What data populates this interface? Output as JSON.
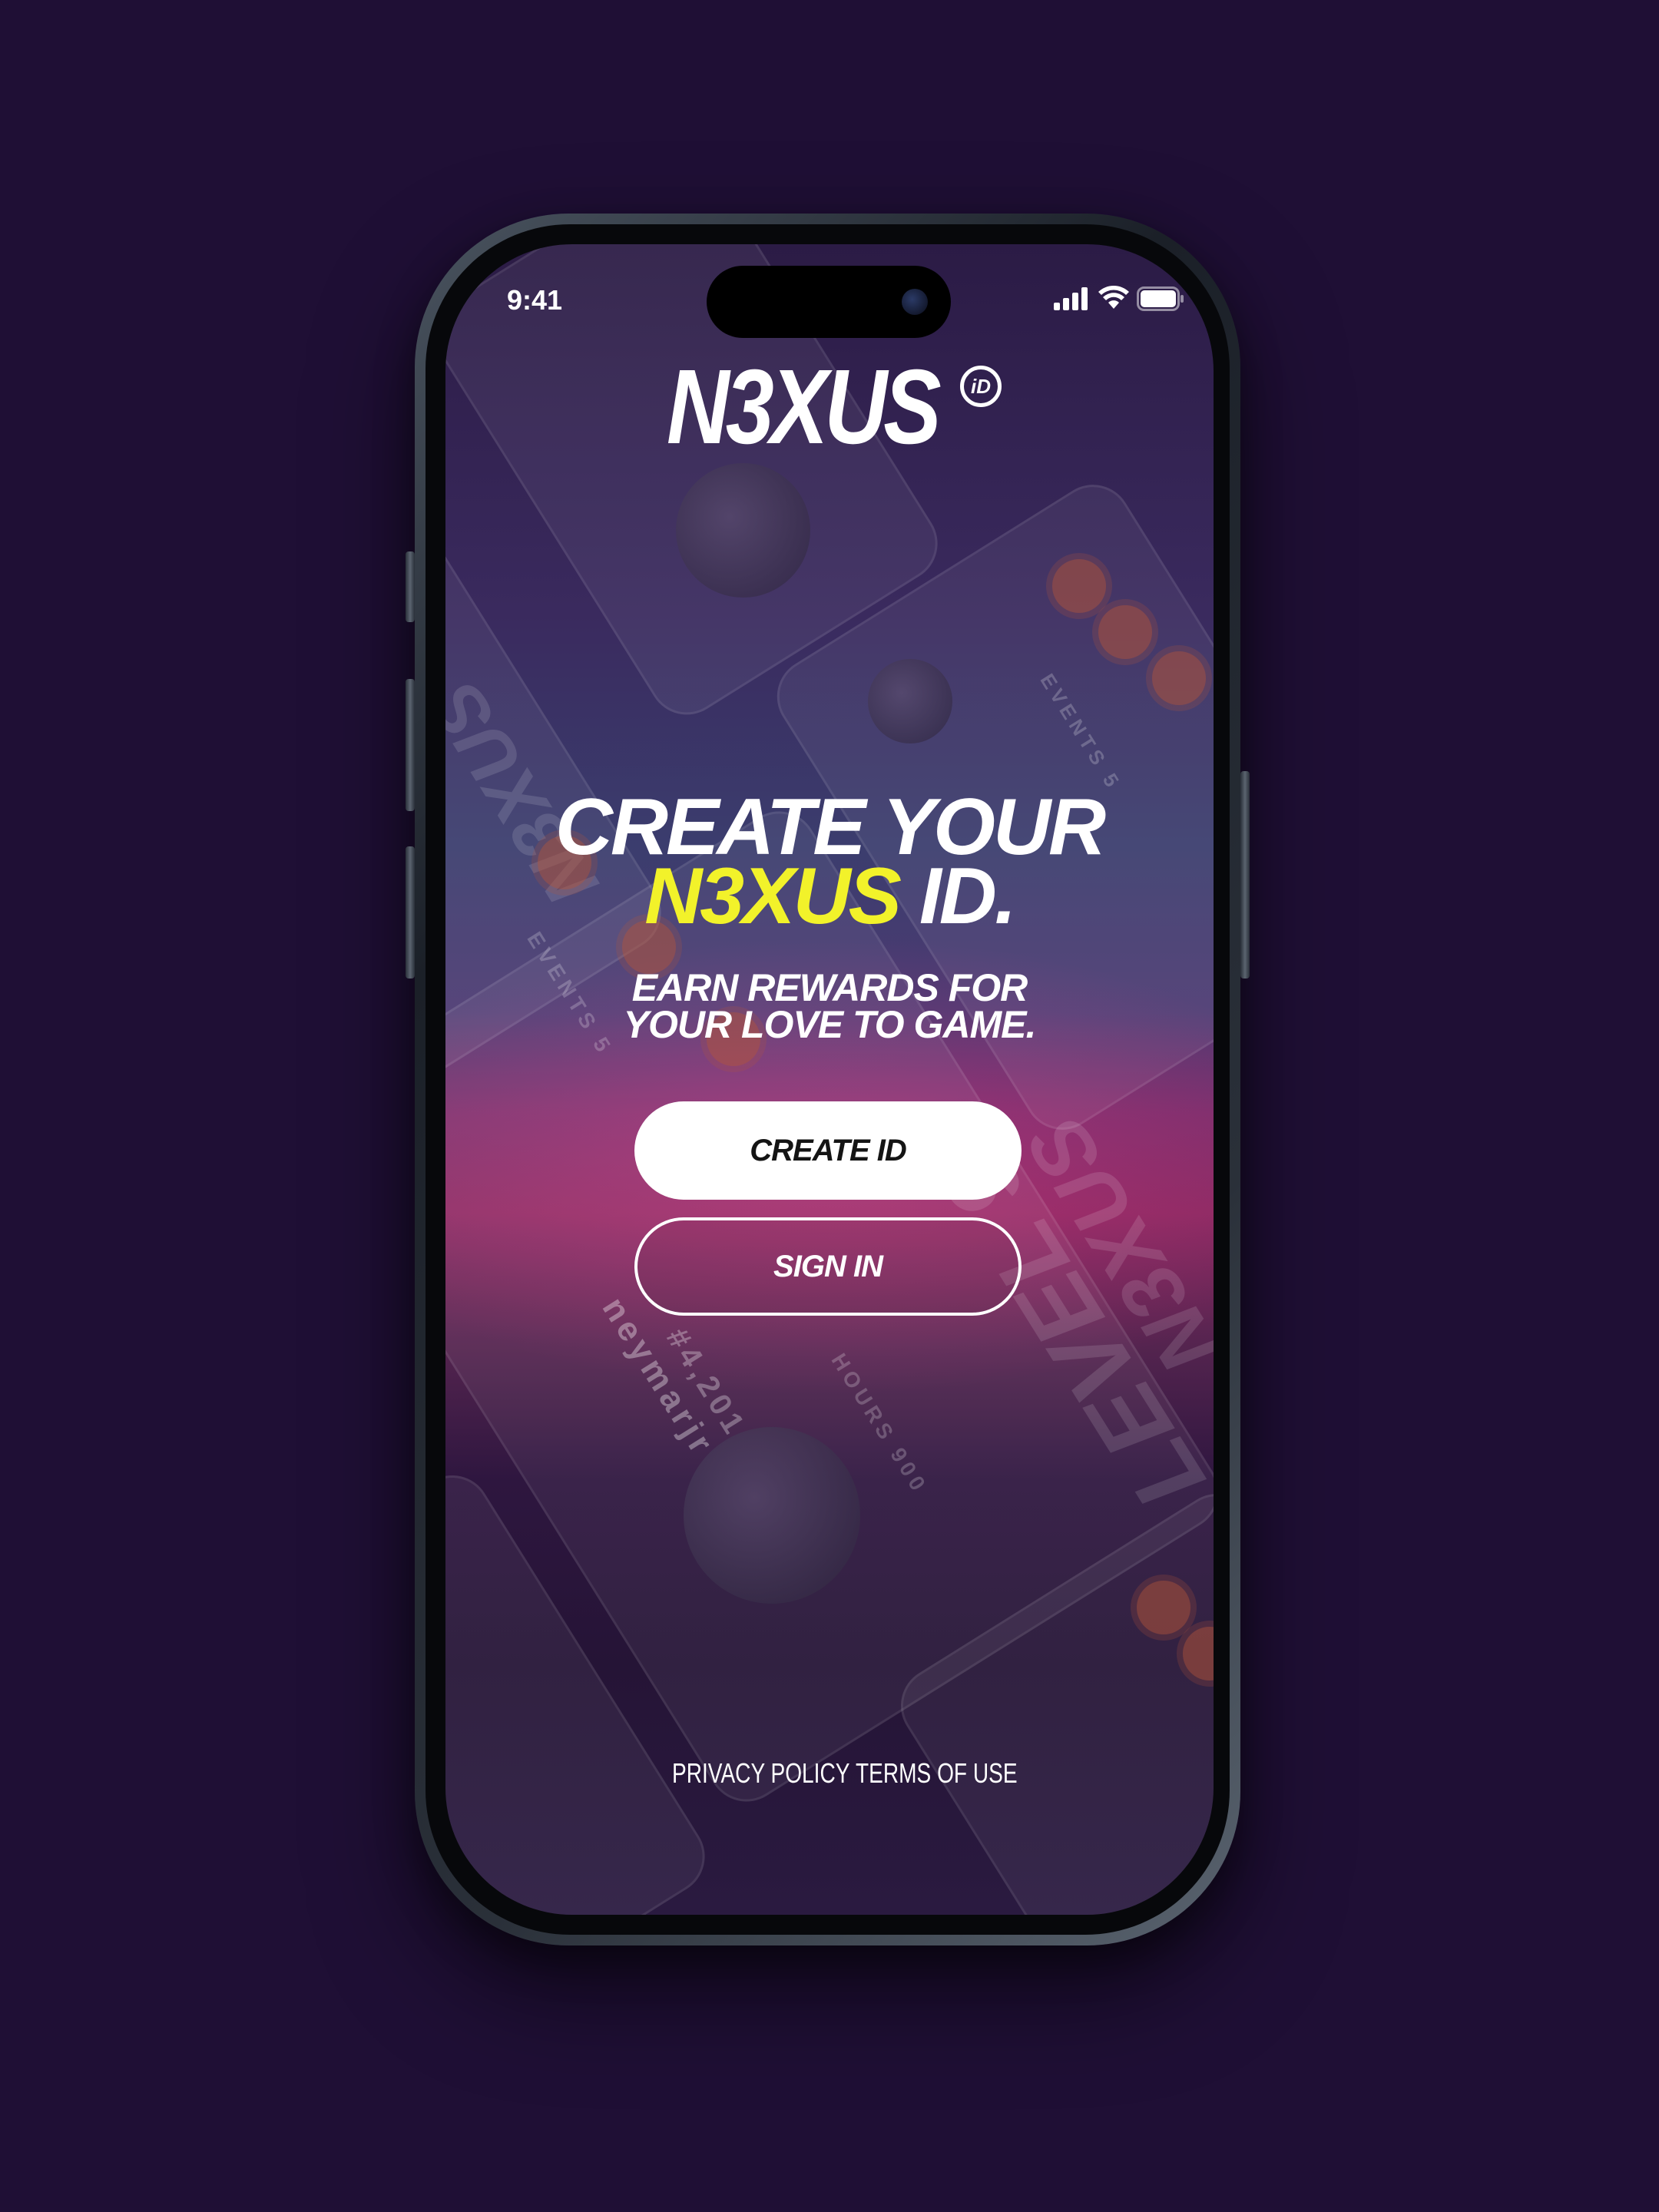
{
  "status_bar": {
    "time": "9:41",
    "icons": [
      "signal-icon",
      "wifi-icon",
      "battery-icon"
    ]
  },
  "logo": {
    "text": "N3XUS",
    "badge": "iD"
  },
  "headline": {
    "line1": "CREATE YOUR",
    "line2_accent": "N3XUS",
    "line2_rest": " ID."
  },
  "subheadline": {
    "line1": "EARN REWARDS FOR",
    "line2": "YOUR LOVE TO GAME."
  },
  "buttons": {
    "create_id": "CREATE ID",
    "sign_in": "SIGN IN"
  },
  "footer": {
    "privacy_policy": "PRIVACY POLICY",
    "terms_of_use": "TERMS OF USE"
  },
  "colors": {
    "background": "#1f0f35",
    "accent_yellow": "#f2f22a",
    "button_primary_bg": "#ffffff",
    "text": "#ffffff"
  }
}
